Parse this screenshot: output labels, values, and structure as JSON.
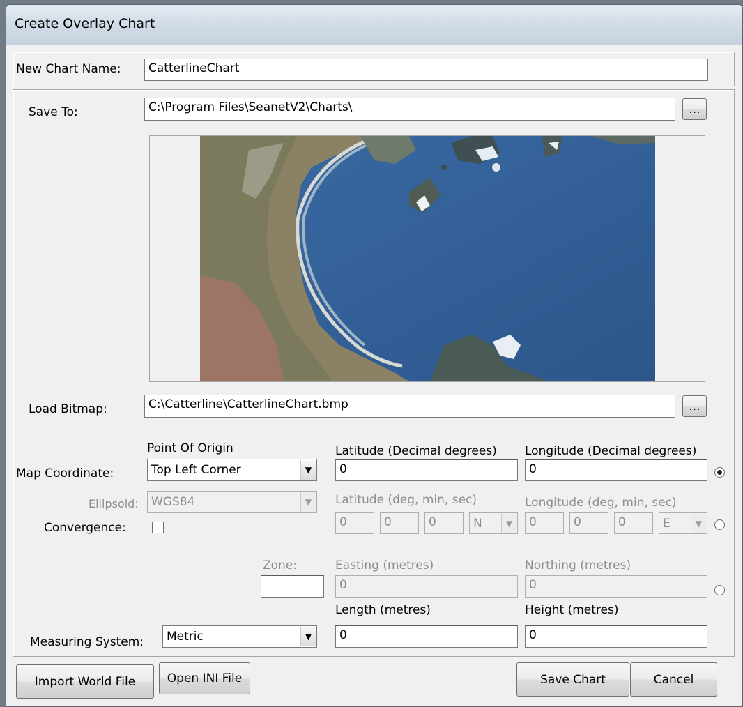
{
  "window": {
    "title": "Create Overlay Chart"
  },
  "chart_name": {
    "label": "New Chart Name:",
    "value": "CatterlineChart"
  },
  "save_to": {
    "label": "Save To:",
    "value": "C:\\Program Files\\SeanetV2\\Charts\\",
    "browse_label": "..."
  },
  "load_bitmap": {
    "label": "Load Bitmap:",
    "value": "C:\\Catterline\\CatterlineChart.bmp",
    "browse_label": "..."
  },
  "map_coordinate": {
    "label": "Map Coordinate:",
    "origin_header": "Point Of Origin",
    "origin_value": "Top Left Corner",
    "latitude_header": "Latitude (Decimal degrees)",
    "longitude_header": "Longitude (Decimal degrees)",
    "latitude_value": "0",
    "longitude_value": "0",
    "mode_selected": true
  },
  "ellipsoid": {
    "label": "Ellipsoid:",
    "value": "WGS84"
  },
  "dms": {
    "latitude_header": "Latitude (deg, min, sec)",
    "longitude_header": "Longitude (deg, min, sec)",
    "lat_deg": "0",
    "lat_min": "0",
    "lat_sec": "0",
    "lat_hemi": "N",
    "lon_deg": "0",
    "lon_min": "0",
    "lon_sec": "0",
    "lon_hemi": "E",
    "mode_selected": false
  },
  "convergence": {
    "label": "Convergence:",
    "checked": false
  },
  "utm": {
    "zone_label": "Zone:",
    "zone_value": "",
    "easting_header": "Easting (metres)",
    "northing_header": "Northing (metres)",
    "easting_value": "0",
    "northing_value": "0",
    "mode_selected": false
  },
  "size": {
    "length_header": "Length (metres)",
    "height_header": "Height (metres)",
    "length_value": "0",
    "height_value": "0"
  },
  "measuring_system": {
    "label": "Measuring System:",
    "value": "Metric"
  },
  "buttons": {
    "import_world_file": "Import World File",
    "open_ini_file": "Open INI File",
    "save_chart": "Save Chart",
    "cancel": "Cancel"
  }
}
